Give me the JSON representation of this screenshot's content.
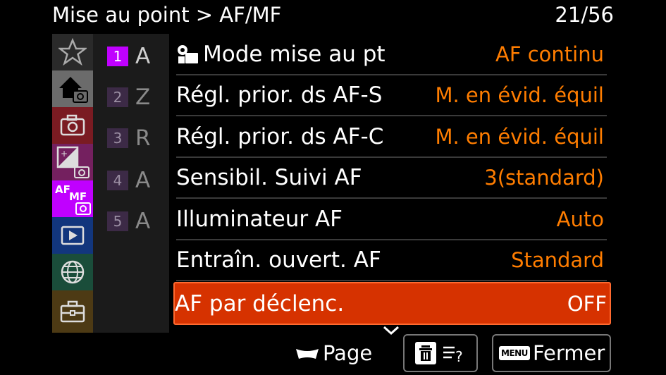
{
  "header": {
    "title": "Mise au point > AF/MF",
    "page": "21/56"
  },
  "categories": [
    {
      "icon": "star-icon",
      "active": false
    },
    {
      "icon": "home-camera-icon",
      "active": false
    },
    {
      "icon": "camera-icon",
      "active": false
    },
    {
      "icon": "exposure-camera-icon",
      "active": false
    },
    {
      "icon": "af-mf-camera-icon",
      "label": "AF MF",
      "active": true
    },
    {
      "icon": "playback-icon",
      "active": false
    },
    {
      "icon": "network-icon",
      "active": false
    },
    {
      "icon": "toolbox-icon",
      "active": false
    }
  ],
  "subpages": [
    {
      "num": "1",
      "letter": "A",
      "active": true
    },
    {
      "num": "2",
      "letter": "Z",
      "active": false
    },
    {
      "num": "3",
      "letter": "R",
      "active": false
    },
    {
      "num": "4",
      "letter": "A",
      "active": false
    },
    {
      "num": "5",
      "letter": "A",
      "active": false
    }
  ],
  "rows": [
    {
      "label": "Mode mise au pt",
      "value": "AF continu",
      "icon": "focus-mode-icon"
    },
    {
      "label": "Régl. prior. ds AF-S",
      "value": "M. en évid. équil"
    },
    {
      "label": "Régl. prior. ds AF-C",
      "value": "M. en évid. équil"
    },
    {
      "label": "Sensibil. Suivi AF",
      "value": "3(standard)"
    },
    {
      "label": "Illuminateur AF",
      "value": "Auto"
    },
    {
      "label": "Entraîn. ouvert. AF",
      "value": "Standard"
    },
    {
      "label": "AF par déclenc.",
      "value": "OFF",
      "selected": true
    }
  ],
  "footer": {
    "page_label": "Page",
    "menu_key": "MENU",
    "close_label": "Fermer"
  },
  "colors": {
    "accent": "#c000ff",
    "value": "#ff7d00",
    "selected": "#d63200"
  }
}
